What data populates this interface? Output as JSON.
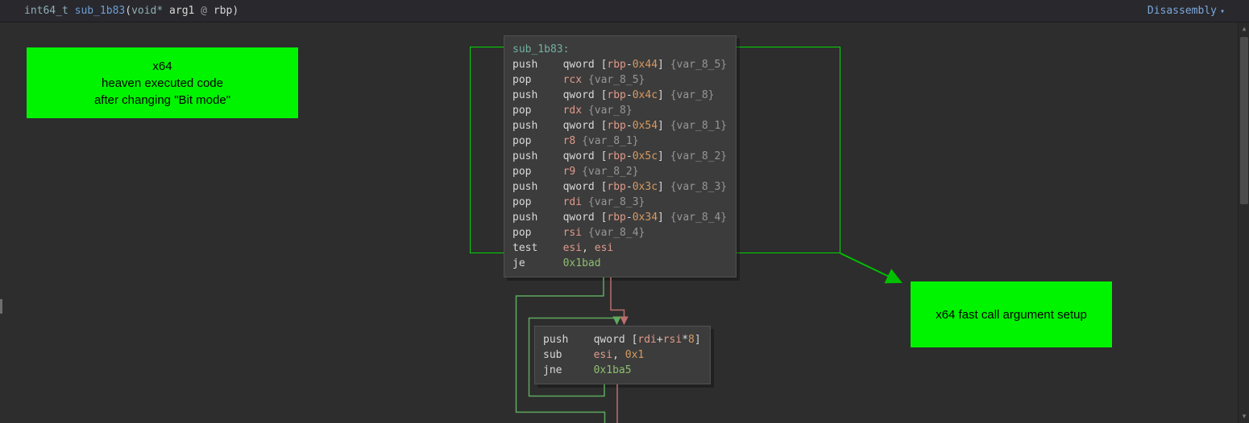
{
  "titlebar": {
    "signature_tokens": [
      [
        "int64_t ",
        "type"
      ],
      [
        "sub_1b83",
        "func"
      ],
      [
        "(",
        "plain"
      ],
      [
        "void*",
        "type"
      ],
      [
        " ",
        "plain"
      ],
      [
        "arg1",
        "plain"
      ],
      [
        " @ ",
        "at"
      ],
      [
        "rbp",
        "plain"
      ],
      [
        ")",
        "plain"
      ]
    ],
    "view_selector": "Disassembly"
  },
  "icons": {
    "dropdown_caret": "▾",
    "scroll_up": "▲",
    "scroll_down": "▼"
  },
  "annotations": [
    {
      "lines": [
        "x64",
        "heaven executed code",
        "after changing \"Bit mode\""
      ]
    },
    {
      "lines": [
        "x64 fast call argument setup"
      ]
    }
  ],
  "graph": {
    "blocks": [
      {
        "label": "sub_1b83:",
        "instructions": [
          {
            "mn": "push",
            "ops": [
              [
                "qword [",
                "plain"
              ],
              [
                "rbp",
                "reg"
              ],
              [
                "-",
                "plain"
              ],
              [
                "0x44",
                "num"
              ],
              [
                "]",
                "plain"
              ],
              [
                " ",
                "plain"
              ],
              [
                "{var_8_5}",
                "var"
              ]
            ]
          },
          {
            "mn": "pop",
            "ops": [
              [
                "rcx",
                "reg"
              ],
              [
                " ",
                "plain"
              ],
              [
                "{var_8_5}",
                "var"
              ]
            ]
          },
          {
            "mn": "push",
            "ops": [
              [
                "qword [",
                "plain"
              ],
              [
                "rbp",
                "reg"
              ],
              [
                "-",
                "plain"
              ],
              [
                "0x4c",
                "num"
              ],
              [
                "]",
                "plain"
              ],
              [
                " ",
                "plain"
              ],
              [
                "{var_8}",
                "var"
              ]
            ]
          },
          {
            "mn": "pop",
            "ops": [
              [
                "rdx",
                "reg"
              ],
              [
                " ",
                "plain"
              ],
              [
                "{var_8}",
                "var"
              ]
            ]
          },
          {
            "mn": "push",
            "ops": [
              [
                "qword [",
                "plain"
              ],
              [
                "rbp",
                "reg"
              ],
              [
                "-",
                "plain"
              ],
              [
                "0x54",
                "num"
              ],
              [
                "]",
                "plain"
              ],
              [
                " ",
                "plain"
              ],
              [
                "{var_8_1}",
                "var"
              ]
            ]
          },
          {
            "mn": "pop",
            "ops": [
              [
                "r8",
                "reg"
              ],
              [
                " ",
                "plain"
              ],
              [
                "{var_8_1}",
                "var"
              ]
            ]
          },
          {
            "mn": "push",
            "ops": [
              [
                "qword [",
                "plain"
              ],
              [
                "rbp",
                "reg"
              ],
              [
                "-",
                "plain"
              ],
              [
                "0x5c",
                "num"
              ],
              [
                "]",
                "plain"
              ],
              [
                " ",
                "plain"
              ],
              [
                "{var_8_2}",
                "var"
              ]
            ]
          },
          {
            "mn": "pop",
            "ops": [
              [
                "r9",
                "reg"
              ],
              [
                " ",
                "plain"
              ],
              [
                "{var_8_2}",
                "var"
              ]
            ]
          },
          {
            "mn": "push",
            "ops": [
              [
                "qword [",
                "plain"
              ],
              [
                "rbp",
                "reg"
              ],
              [
                "-",
                "plain"
              ],
              [
                "0x3c",
                "num"
              ],
              [
                "]",
                "plain"
              ],
              [
                " ",
                "plain"
              ],
              [
                "{var_8_3}",
                "var"
              ]
            ]
          },
          {
            "mn": "pop",
            "ops": [
              [
                "rdi",
                "reg"
              ],
              [
                " ",
                "plain"
              ],
              [
                "{var_8_3}",
                "var"
              ]
            ]
          },
          {
            "mn": "push",
            "ops": [
              [
                "qword [",
                "plain"
              ],
              [
                "rbp",
                "reg"
              ],
              [
                "-",
                "plain"
              ],
              [
                "0x34",
                "num"
              ],
              [
                "]",
                "plain"
              ],
              [
                " ",
                "plain"
              ],
              [
                "{var_8_4}",
                "var"
              ]
            ]
          },
          {
            "mn": "pop",
            "ops": [
              [
                "rsi",
                "reg"
              ],
              [
                " ",
                "plain"
              ],
              [
                "{var_8_4}",
                "var"
              ]
            ]
          },
          {
            "mn": "test",
            "ops": [
              [
                "esi",
                "reg"
              ],
              [
                ", ",
                "plain"
              ],
              [
                "esi",
                "reg"
              ]
            ]
          },
          {
            "mn": "je",
            "ops": [
              [
                "0x1bad",
                "target"
              ]
            ]
          }
        ]
      },
      {
        "label": null,
        "instructions": [
          {
            "mn": "push",
            "ops": [
              [
                "qword [",
                "plain"
              ],
              [
                "rdi",
                "reg"
              ],
              [
                "+",
                "plain"
              ],
              [
                "rsi",
                "reg"
              ],
              [
                "*",
                "plain"
              ],
              [
                "8",
                "num"
              ],
              [
                "]",
                "plain"
              ]
            ]
          },
          {
            "mn": "sub",
            "ops": [
              [
                "esi",
                "reg"
              ],
              [
                ", ",
                "plain"
              ],
              [
                "0x1",
                "num"
              ]
            ]
          },
          {
            "mn": "jne",
            "ops": [
              [
                "0x1ba5",
                "target"
              ]
            ]
          }
        ]
      }
    ]
  },
  "colors": {
    "annotation_bg": "#00f400",
    "selection": "#00d800",
    "annotation_arrow": "#00c000",
    "edge_true": "#5fa85f",
    "edge_false": "#bc6f6f"
  }
}
